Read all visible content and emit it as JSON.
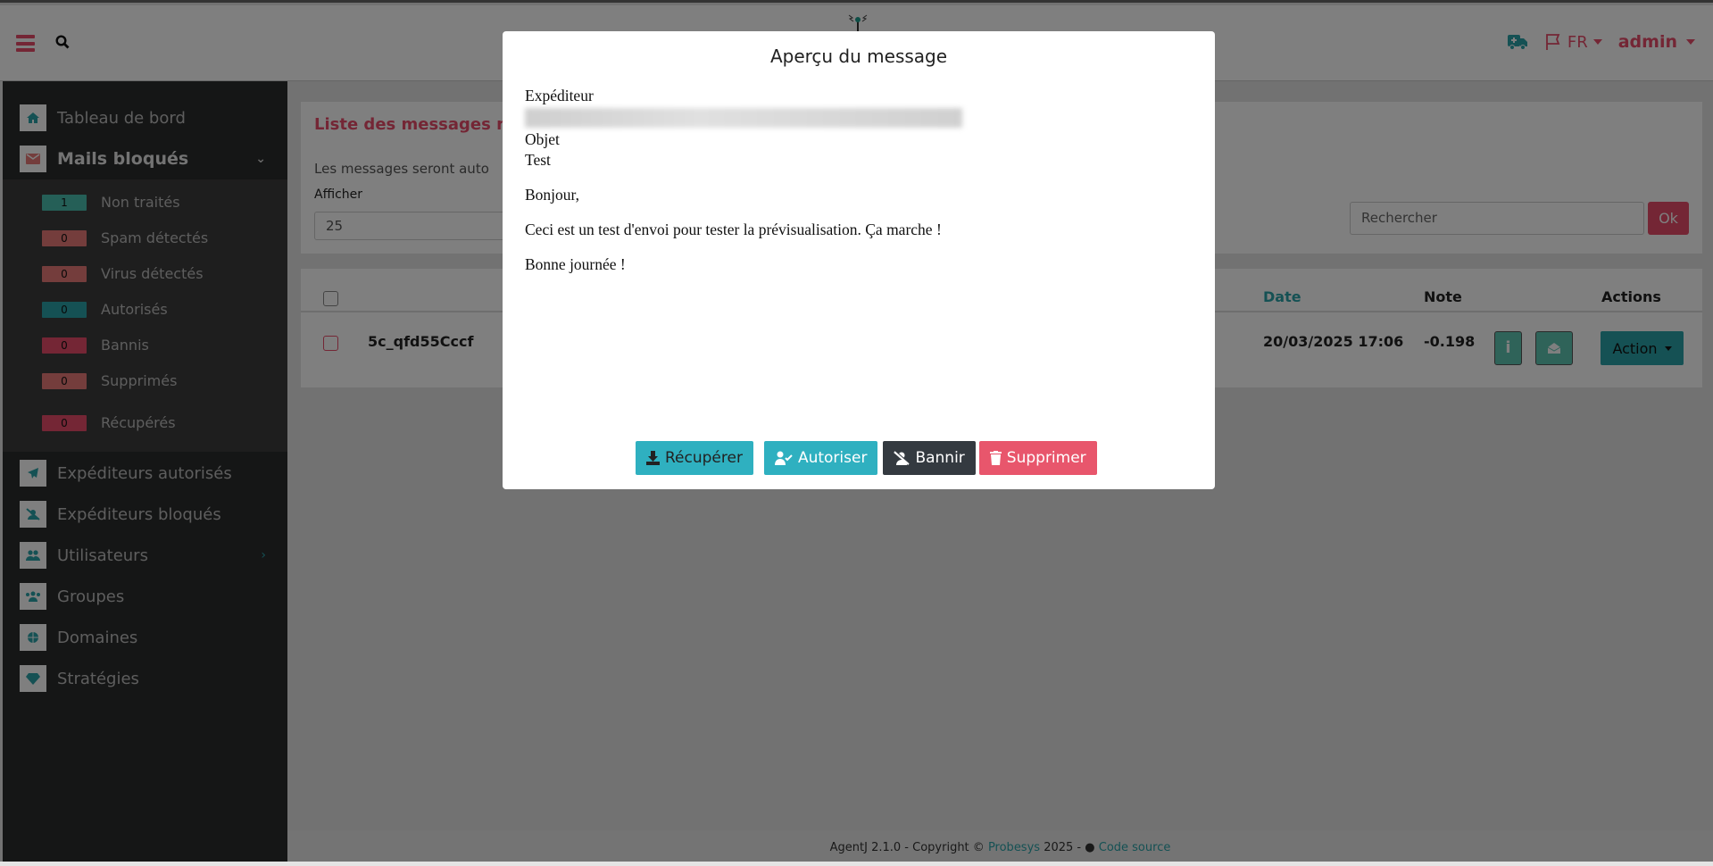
{
  "header": {
    "icons": [
      "hamburger-icon",
      "search-icon",
      "ambulance-icon",
      "flag-icon"
    ],
    "language": "FR",
    "user": "admin"
  },
  "sidebar": {
    "items": [
      {
        "label": "Tableau de bord",
        "icon": "home-icon"
      },
      {
        "label": "Mails bloqués",
        "icon": "envelope-icon"
      },
      {
        "label": "Expéditeurs autorisés",
        "icon": "paper-plane-icon"
      },
      {
        "label": "Expéditeurs bloqués",
        "icon": "user-slash-icon"
      },
      {
        "label": "Utilisateurs",
        "icon": "users-icon"
      },
      {
        "label": "Groupes",
        "icon": "user-group-icon"
      },
      {
        "label": "Domaines",
        "icon": "globe-icon"
      },
      {
        "label": "Stratégies",
        "icon": "gem-icon"
      }
    ],
    "submenu": [
      {
        "label": "Non traités",
        "count": "1",
        "color": "#4bbfae"
      },
      {
        "label": "Spam détectés",
        "count": "0",
        "color": "#e87a78"
      },
      {
        "label": "Virus détectés",
        "count": "0",
        "color": "#e87a78"
      },
      {
        "label": "Autorisés",
        "count": "0",
        "color": "#2aa3a8"
      },
      {
        "label": "Bannis",
        "count": "0",
        "color": "#e84d6a"
      },
      {
        "label": "Supprimés",
        "count": "0",
        "color": "#e87a78"
      },
      {
        "label": "Récupérés",
        "count": "0",
        "color": "#e84d6a"
      }
    ]
  },
  "main": {
    "title": "Liste des messages no",
    "info": "Les messages seront auto",
    "show_label": "Afficher",
    "show_value": "25",
    "search_placeholder": "Rechercher",
    "ok_label": "Ok",
    "table": {
      "headers": {
        "date": "Date",
        "note": "Note",
        "actions": "Actions"
      },
      "rows": [
        {
          "id": "5c_qfd55Cccf",
          "date": "20/03/2025 17:06",
          "note": "-0.198",
          "action_label": "Action"
        }
      ]
    }
  },
  "footer": {
    "text": "AgentJ 2.1.0 - Copyright ©",
    "brand": "Probesys",
    "year": "2025 -",
    "source": "Code source"
  },
  "modal": {
    "title": "Aperçu du message",
    "sender_label": "Expéditeur",
    "subject_label": "Objet",
    "subject": "Test",
    "body": [
      "Bonjour,",
      "Ceci est un test d'envoi pour tester la prévisualisation. Ça marche !",
      "Bonne journée !"
    ],
    "buttons": [
      {
        "label": "Récupérer",
        "color": "#2fb0c0",
        "icon": "download-icon"
      },
      {
        "label": "Autoriser",
        "color": "#2fb0c0",
        "icon": "user-check-icon"
      },
      {
        "label": "Bannir",
        "color": "#343a40",
        "icon": "user-slash-icon"
      },
      {
        "label": "Supprimer",
        "color": "#e8566c",
        "icon": "trash-icon"
      }
    ]
  }
}
